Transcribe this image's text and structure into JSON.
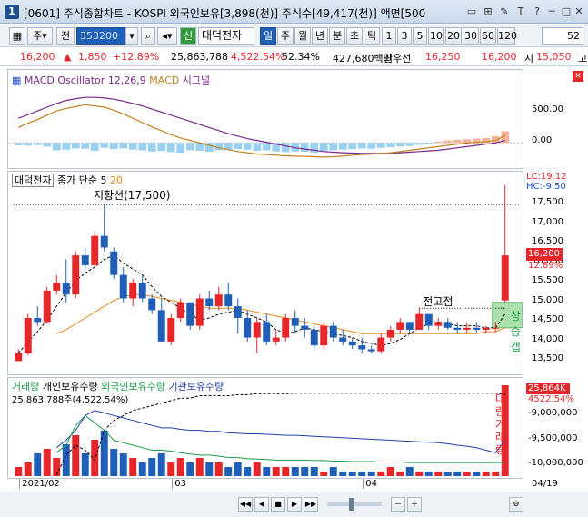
{
  "window": {
    "number": "1",
    "title": "[0601] 주식종합차트 - KOSPI 외국인보유[3,898(천)] 주식수[49,417(천)] 액면[500"
  },
  "toolbar": {
    "market": "주",
    "all": "전",
    "code": "353200",
    "new_badge": "신",
    "stock_name": "대덕전자",
    "periods": [
      "일",
      "주",
      "월",
      "년",
      "분",
      "초",
      "틱"
    ],
    "active_period": "일",
    "intervals": [
      "1",
      "3",
      "5",
      "10",
      "20",
      "30",
      "60",
      "120"
    ],
    "count": "52"
  },
  "quote": {
    "price": "16,200",
    "change": "1,850",
    "change_pct": "+12.89%",
    "volume": "25,863,788",
    "volume_pct": "4,522.54%",
    "pct2": "52.34%",
    "amount": "427,680백만",
    "best_bid_label": "최우선",
    "best1": "16,250",
    "best2": "16,200",
    "open_label": "시",
    "open": "15,050",
    "end": "고"
  },
  "macd": {
    "legend_title": "MACD Oscillator 12,26,9",
    "legend_macd": "MACD",
    "legend_signal": "시그널",
    "ticks": [
      "500.00",
      "0.00"
    ],
    "colors": {
      "macd": "#c0821f",
      "signal": "#7a2a8a",
      "pos": "#f4b39a",
      "neg": "#9ad0f0"
    },
    "osc": [
      -40,
      -45,
      -35,
      -60,
      -120,
      -110,
      -90,
      -95,
      -130,
      -80,
      -100,
      -90,
      -110,
      -120,
      -140,
      -130,
      -150,
      -160,
      -120,
      -130,
      -145,
      -120,
      -110,
      -100,
      -110,
      -130,
      -120,
      -140,
      -150,
      -140,
      -145,
      -160,
      -130,
      -120,
      -110,
      -100,
      -90,
      -95,
      -80,
      -70,
      -60,
      -50,
      -30,
      -20,
      20,
      40,
      50,
      60,
      70,
      80,
      110,
      190
    ],
    "macd_line": [
      250,
      320,
      380,
      450,
      520,
      560,
      590,
      620,
      600,
      580,
      530,
      470,
      400,
      330,
      260,
      200,
      130,
      80,
      40,
      0,
      -40,
      -80,
      -110,
      -140,
      -160,
      -180,
      -190,
      -200,
      -210,
      -215,
      -220,
      -225,
      -230,
      -225,
      -215,
      -200,
      -190,
      -180,
      -170,
      -160,
      -140,
      -120,
      -100,
      -80,
      -60,
      -40,
      -20,
      0,
      10,
      20,
      40,
      120
    ],
    "signal_line": [
      400,
      460,
      520,
      580,
      640,
      690,
      720,
      740,
      740,
      730,
      710,
      680,
      640,
      600,
      550,
      500,
      450,
      400,
      350,
      300,
      250,
      200,
      150,
      110,
      70,
      40,
      10,
      -20,
      -50,
      -80,
      -100,
      -120,
      -140,
      -150,
      -160,
      -165,
      -170,
      -170,
      -170,
      -165,
      -160,
      -150,
      -140,
      -130,
      -120,
      -100,
      -80,
      -60,
      -40,
      -20,
      0,
      40
    ],
    "ymin": -350,
    "ymax": 950
  },
  "price": {
    "stock_label": "대덕전자",
    "ma_label": "종가 단순 5",
    "ma_period": "20",
    "lc": "LC:19.12",
    "hc": "HC:-9.50",
    "resistance_label": "저항선(17,500)",
    "prev_high_label": "전고점",
    "gap_label": "상승갭",
    "current_price": "16,200",
    "current_pct": "12.89%",
    "ticks": [
      "17,500",
      "17,000",
      "16,500",
      "16,000",
      "15,500",
      "15,000",
      "14,500",
      "14,000",
      "13,500"
    ],
    "ymin": 13300,
    "ymax": 18200,
    "resistance": 17500,
    "prev_high": 14850,
    "gap": [
      14350,
      15000
    ],
    "colors": {
      "up": "#e5262b",
      "down": "#1f5fb8",
      "ma5": "#000000",
      "ma20": "#e68a1a"
    },
    "candles": [
      [
        13500,
        13800,
        13550,
        13700
      ],
      [
        13700,
        14700,
        13650,
        14600
      ],
      [
        14600,
        14900,
        14400,
        14500
      ],
      [
        14500,
        15400,
        14450,
        15300
      ],
      [
        15300,
        15700,
        15200,
        15500
      ],
      [
        15500,
        16100,
        15000,
        15200
      ],
      [
        15200,
        16300,
        15100,
        16200
      ],
      [
        16200,
        16400,
        15800,
        15950
      ],
      [
        15950,
        16800,
        15900,
        16700
      ],
      [
        16700,
        17500,
        16300,
        16400
      ],
      [
        16300,
        16400,
        15600,
        15700
      ],
      [
        15700,
        15900,
        15000,
        15100
      ],
      [
        15100,
        15600,
        14900,
        15500
      ],
      [
        15500,
        15700,
        15000,
        15100
      ],
      [
        15100,
        15200,
        14700,
        14800
      ],
      [
        14800,
        15100,
        14000,
        14000
      ],
      [
        14000,
        14700,
        13900,
        14600
      ],
      [
        14600,
        15100,
        14500,
        15000
      ],
      [
        15000,
        15000,
        14300,
        14400
      ],
      [
        14400,
        15200,
        14300,
        15100
      ],
      [
        15100,
        15300,
        14800,
        14900
      ],
      [
        14900,
        15400,
        14800,
        15200
      ],
      [
        15200,
        15500,
        14800,
        14900
      ],
      [
        14900,
        15100,
        14200,
        14600
      ],
      [
        14600,
        14800,
        14000,
        14100
      ],
      [
        14100,
        14600,
        13700,
        14500
      ],
      [
        14500,
        14700,
        13900,
        14000
      ],
      [
        14000,
        14300,
        13900,
        14100
      ],
      [
        14100,
        14700,
        14000,
        14600
      ],
      [
        14600,
        14800,
        14200,
        14400
      ],
      [
        14400,
        14600,
        14100,
        14300
      ],
      [
        14300,
        14400,
        13800,
        13900
      ],
      [
        13900,
        14500,
        13800,
        14400
      ],
      [
        14400,
        14500,
        14000,
        14100
      ],
      [
        14100,
        14300,
        13900,
        14000
      ],
      [
        14000,
        14100,
        13800,
        13900
      ],
      [
        13900,
        14100,
        13700,
        13800
      ],
      [
        13800,
        13900,
        13700,
        13750
      ],
      [
        13750,
        14200,
        13700,
        14100
      ],
      [
        14100,
        14400,
        14000,
        14300
      ],
      [
        14300,
        14600,
        14200,
        14500
      ],
      [
        14500,
        14500,
        14200,
        14300
      ],
      [
        14300,
        14850,
        14300,
        14700
      ],
      [
        14700,
        14700,
        14300,
        14400
      ],
      [
        14400,
        14600,
        14300,
        14500
      ],
      [
        14500,
        14600,
        14300,
        14350
      ],
      [
        14350,
        14500,
        14200,
        14300
      ],
      [
        14300,
        14500,
        14200,
        14350
      ],
      [
        14350,
        14500,
        14200,
        14300
      ],
      [
        14300,
        14400,
        14200,
        14350
      ],
      [
        14350,
        14500,
        14250,
        14350
      ],
      [
        15050,
        18000,
        15000,
        16200
      ]
    ],
    "ma5": [
      13700,
      14000,
      14250,
      14550,
      14900,
      15250,
      15550,
      15750,
      15900,
      16100,
      16200,
      16000,
      15850,
      15700,
      15400,
      15150,
      15000,
      14850,
      14700,
      14550,
      14600,
      14700,
      14750,
      14800,
      14700,
      14600,
      14500,
      14300,
      14200,
      14250,
      14350,
      14300,
      14250,
      14200,
      14150,
      14100,
      14000,
      13950,
      13900,
      13950,
      14050,
      14200,
      14350,
      14450,
      14500,
      14450,
      14400,
      14400,
      14400,
      14350,
      14350,
      14700
    ],
    "ma20": [
      null,
      null,
      null,
      null,
      14200,
      14300,
      14450,
      14600,
      14750,
      14900,
      15050,
      15150,
      15200,
      15200,
      15150,
      15100,
      15050,
      15000,
      14950,
      14900,
      14850,
      14850,
      14850,
      14850,
      14800,
      14750,
      14700,
      14650,
      14600,
      14550,
      14500,
      14450,
      14400,
      14350,
      14300,
      14250,
      14200,
      14200,
      14200,
      14200,
      14200,
      14200,
      14200,
      14200,
      14200,
      14200,
      14200,
      14200,
      14200,
      14250,
      14250,
      14350
    ]
  },
  "volume": {
    "legend_vol": "거래량",
    "legend_indiv": "개인보유수량",
    "legend_foreign": "외국인보유수량",
    "legend_inst": "기관보유수량",
    "value_label": "25,863,788주(4,522.54%)",
    "side_label": "대량거래량",
    "current_value": "25,864K",
    "current_pct": "4522.54%",
    "ticks": [
      "-9,000,000",
      "-9,500,000",
      "-10,000,000"
    ],
    "colors": {
      "vol": "#1f9b4b",
      "indiv": "#000000",
      "foreign": "#1f9b4b",
      "inst": "#1f3fa8"
    },
    "bars": [
      2,
      3,
      5,
      6,
      4,
      7,
      9,
      5,
      8,
      10,
      6,
      5,
      4,
      3,
      4,
      5,
      3,
      4,
      3,
      4,
      3,
      3,
      2,
      3,
      2,
      3,
      2,
      2,
      2,
      2,
      2,
      2,
      1,
      2,
      1,
      1,
      1,
      1,
      1,
      2,
      1,
      2,
      1,
      1,
      1,
      1,
      1,
      1,
      1,
      1,
      1,
      100
    ],
    "indiv": [
      null,
      null,
      null,
      null,
      -10200,
      -9800,
      -9600,
      -9700,
      -9900,
      -9300,
      -9100,
      -9000,
      -8900,
      -8850,
      -8800,
      -8750,
      -8700,
      -8650,
      -8650,
      -8600,
      -8600,
      -8600,
      -8600,
      -8580,
      -8580,
      -8560,
      -8560,
      -8560,
      -8560,
      -8550,
      -8550,
      -8550,
      -8550,
      -8550,
      -8550,
      -8550,
      -8550,
      -8550,
      -8550,
      -8550,
      -8550,
      -8550,
      -8550,
      -8550,
      -8550,
      -8550,
      -8550,
      -8550,
      -8550,
      -8550,
      -8550,
      -8580
    ],
    "foreign": [
      null,
      null,
      null,
      null,
      -9750,
      -9600,
      -9200,
      -9000,
      -9150,
      -9300,
      -9500,
      -9550,
      -9600,
      -9650,
      -9700,
      -9700,
      -9720,
      -9750,
      -9780,
      -9800,
      -9800,
      -9820,
      -9850,
      -9850,
      -9870,
      -9880,
      -9890,
      -9900,
      -9900,
      -9900,
      -9900,
      -9910,
      -9910,
      -9920,
      -9920,
      -9930,
      -9930,
      -9930,
      -9940,
      -9940,
      -9940,
      -9950,
      -9950,
      -9950,
      -9950,
      -9950,
      -9950,
      -9950,
      -9950,
      -9950,
      -9950,
      -9950
    ],
    "inst": [
      null,
      null,
      null,
      null,
      -9650,
      -9500,
      -9300,
      -9000,
      -8900,
      -8950,
      -9000,
      -9050,
      -9100,
      -9150,
      -9200,
      -9250,
      -9250,
      -9280,
      -9300,
      -9300,
      -9320,
      -9320,
      -9350,
      -9360,
      -9370,
      -9370,
      -9380,
      -9390,
      -9400,
      -9400,
      -9410,
      -9420,
      -9430,
      -9440,
      -9450,
      -9460,
      -9470,
      -9480,
      -9490,
      -9500,
      -9510,
      -9520,
      -9530,
      -9540,
      -9550,
      -9570,
      -9600,
      -9620,
      -9650,
      -9700,
      -9750,
      -9500
    ],
    "ymin": -10150,
    "ymax": -8500
  },
  "xaxis": {
    "labels": [
      {
        "text": "2021/02",
        "i": 0
      },
      {
        "text": "03",
        "i": 16
      },
      {
        "text": "04",
        "i": 36
      }
    ],
    "end_label": "04/19"
  },
  "bottom": {
    "controls": [
      "◀◀",
      "◀",
      "■",
      "▶",
      "▶▶"
    ]
  }
}
